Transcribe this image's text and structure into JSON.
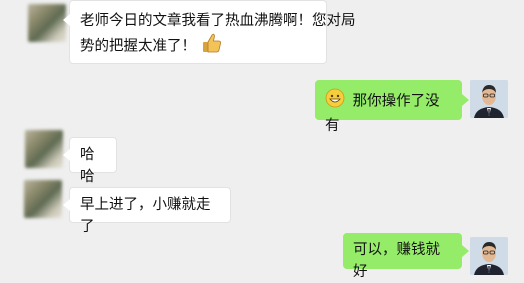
{
  "messages": [
    {
      "side": "left",
      "line1": "老师今日的文章我看了热血沸腾啊！您对局",
      "line2": "势的把握太准了！",
      "trailing_icon": "thumbs-up-icon"
    },
    {
      "side": "right",
      "text": "那你操作了没有",
      "leading_icon": "grinning-face-icon"
    },
    {
      "side": "left",
      "text": "哈哈"
    },
    {
      "side": "left",
      "text": "早上进了，小赚就走了"
    },
    {
      "side": "right",
      "text": "可以，赚钱就好"
    }
  ],
  "colors": {
    "background": "#efefef",
    "incoming_bubble": "#ffffff",
    "outgoing_bubble": "#95ec69"
  }
}
